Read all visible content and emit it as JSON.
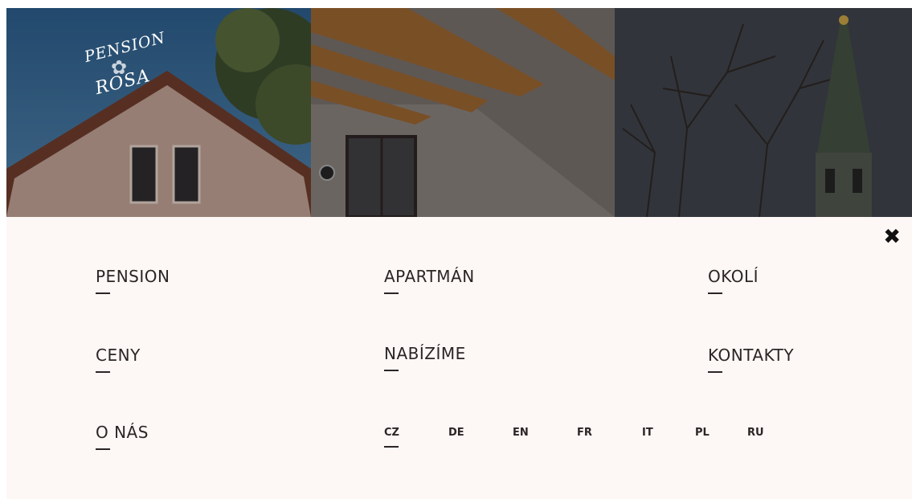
{
  "brand": {
    "line1": "PENSION",
    "line2": "ROSA"
  },
  "hero": {
    "panels": [
      "house-gable-photo",
      "attic-room-photo",
      "church-spire-photo"
    ]
  },
  "menu": {
    "close_icon": "close-icon",
    "items": [
      {
        "label": "PENSION"
      },
      {
        "label": "APARTMÁN"
      },
      {
        "label": "OKOLÍ"
      },
      {
        "label": "CENY"
      },
      {
        "label": "NABÍZÍME"
      },
      {
        "label": "KONTAKTY"
      },
      {
        "label": "O NÁS"
      }
    ]
  },
  "languages": {
    "active": "CZ",
    "items": [
      "CZ",
      "DE",
      "EN",
      "FR",
      "IT",
      "PL",
      "RU"
    ]
  },
  "colors": {
    "menu_bg": "#fdf8f6",
    "text": "#2b2525"
  }
}
